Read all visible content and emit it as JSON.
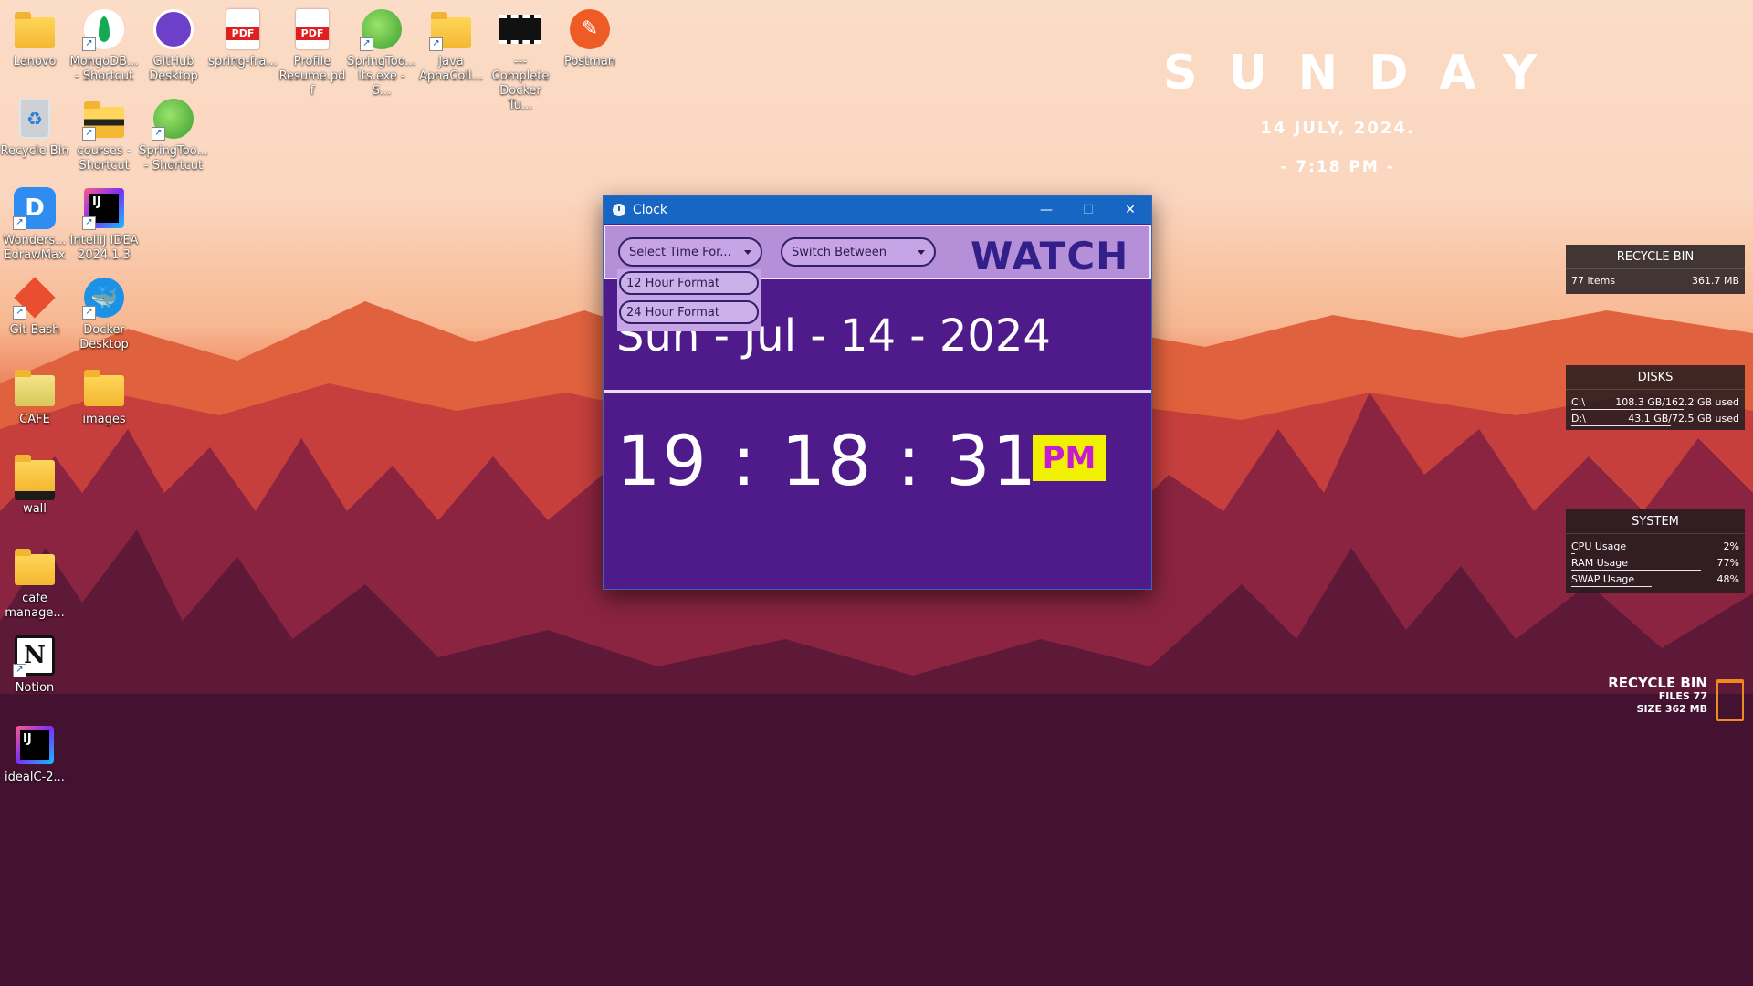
{
  "desktop_icons": [
    {
      "label": "Lenovo"
    },
    {
      "label": "MongoDB... - Shortcut"
    },
    {
      "label": "GitHub Desktop"
    },
    {
      "label": "spring-fra..."
    },
    {
      "label": "Profile Resume.pdf"
    },
    {
      "label": "SpringToo... lts.exe - S..."
    },
    {
      "label": "Java ApnaColl..."
    },
    {
      "label": "---Complete Docker Tu..."
    },
    {
      "label": "Postman"
    },
    {
      "label": "Recycle Bin"
    },
    {
      "label": "courses - Shortcut"
    },
    {
      "label": "SpringToo... - Shortcut"
    },
    {
      "label": "Wonders... EdrawMax"
    },
    {
      "label": "IntelliJ IDEA 2024.1.3"
    },
    {
      "label": "Git Bash"
    },
    {
      "label": "Docker Desktop"
    },
    {
      "label": "CAFE"
    },
    {
      "label": "images"
    },
    {
      "label": "wall"
    },
    {
      "label": "cafe manage..."
    },
    {
      "label": "Notion"
    },
    {
      "label": "idealC-2..."
    }
  ],
  "clock_widget": {
    "day": "SUNDAY",
    "date": "14 JULY, 2024.",
    "time": "- 7:18 PM -"
  },
  "recycle_panel": {
    "title": "RECYCLE BIN",
    "items": "77 items",
    "size": "361.7 MB"
  },
  "disks_panel": {
    "title": "DISKS",
    "rows": [
      {
        "label": "C:\\",
        "value": "108.3 GB/162.2 GB used",
        "fraction": 0.67
      },
      {
        "label": "D:\\",
        "value": "43.1 GB/72.5 GB used",
        "fraction": 0.59
      }
    ]
  },
  "system_panel": {
    "title": "SYSTEM",
    "rows": [
      {
        "label": "CPU Usage",
        "value": "2%",
        "fraction": 0.02
      },
      {
        "label": "RAM Usage",
        "value": "77%",
        "fraction": 0.77
      },
      {
        "label": "SWAP Usage",
        "value": "48%",
        "fraction": 0.48
      }
    ]
  },
  "recycle_mini": {
    "title": "RECYCLE BIN",
    "files": "FILES 77",
    "size": "SIZE 362 MB"
  },
  "clock_window": {
    "title": "Clock",
    "format_combo": "Select Time For...",
    "switch_combo": "Switch Between",
    "watch_label": "WATCH",
    "dropdown_options": [
      "12 Hour Format",
      "24 Hour Format"
    ],
    "date_text": "Sun - Jul - 14 - 2024",
    "time_text": "19 : 18 : 31",
    "ampm": "PM",
    "minimize": "—",
    "maximize": "☐",
    "close": "✕"
  }
}
